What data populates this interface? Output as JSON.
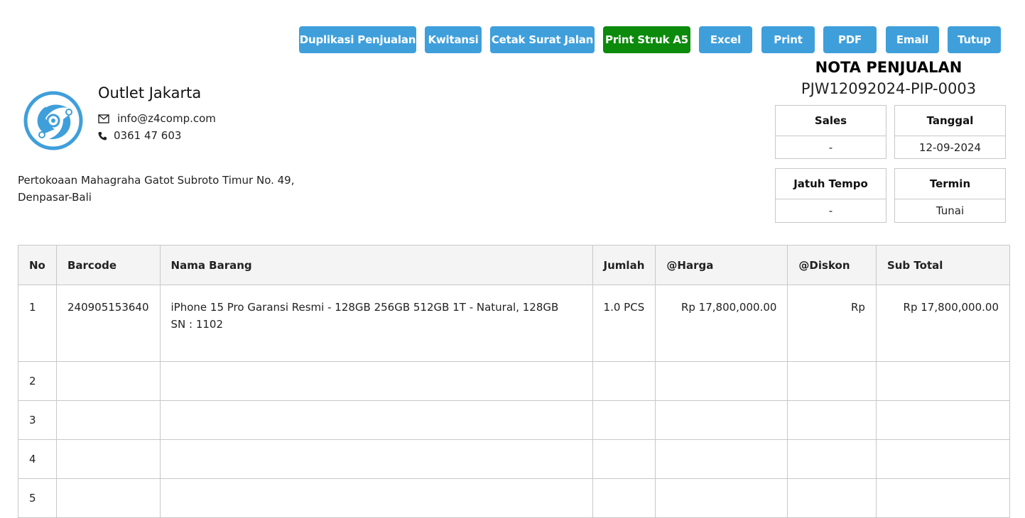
{
  "toolbar": {
    "buttons": [
      {
        "label": "Duplikasi Penjualan",
        "color": "#3f9fdb"
      },
      {
        "label": "Kwitansi",
        "color": "#3f9fdb"
      },
      {
        "label": "Cetak Surat Jalan",
        "color": "#3f9fdb"
      },
      {
        "label": "Print Struk A5",
        "color": "#0b8a0b"
      },
      {
        "label": "Excel",
        "color": "#3f9fdb"
      },
      {
        "label": "Print",
        "color": "#3f9fdb"
      },
      {
        "label": "PDF",
        "color": "#3f9fdb"
      },
      {
        "label": "Email",
        "color": "#3f9fdb"
      },
      {
        "label": "Tutup",
        "color": "#3f9fdb"
      }
    ]
  },
  "company": {
    "name": "Outlet Jakarta",
    "email": "info@z4comp.com",
    "phone": "0361 47 603",
    "address_line1": "Pertokoaan Mahagraha Gatot Subroto Timur No. 49,",
    "address_line2": "Denpasar-Bali",
    "logo_icon": "atom-logo-icon",
    "email_icon": "envelope-icon",
    "phone_icon": "phone-icon"
  },
  "nota": {
    "title": "NOTA PENJUALAN",
    "number": "PJW12092024-PIP-0003",
    "sales_label": "Sales",
    "sales_value": "-",
    "tanggal_label": "Tanggal",
    "tanggal_value": "12-09-2024",
    "jatuh_tempo_label": "Jatuh Tempo",
    "jatuh_tempo_value": "-",
    "termin_label": "Termin",
    "termin_value": "Tunai"
  },
  "table": {
    "headers": {
      "no": "No",
      "barcode": "Barcode",
      "nama": "Nama Barang",
      "jumlah": "Jumlah",
      "harga": "@Harga",
      "diskon": "@Diskon",
      "subtotal": "Sub Total"
    },
    "rows": [
      {
        "no": "1",
        "barcode": "240905153640",
        "nama": "iPhone 15 Pro Garansi Resmi - 128GB 256GB 512GB 1T - Natural, 128GB",
        "sn": "SN : 1102",
        "jumlah": "1.0 PCS",
        "harga": "Rp 17,800,000.00",
        "diskon": "Rp",
        "subtotal": "Rp 17,800,000.00"
      },
      {
        "no": "2"
      },
      {
        "no": "3"
      },
      {
        "no": "4"
      },
      {
        "no": "5"
      }
    ]
  }
}
